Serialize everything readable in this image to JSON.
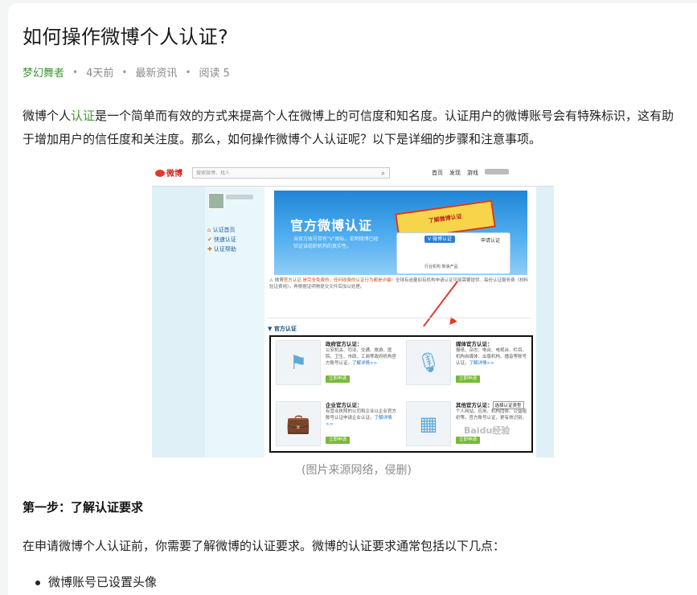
{
  "article": {
    "title": "如何操作微博个人认证?",
    "meta": {
      "author": "梦幻舞者",
      "time": "4天前",
      "category": "最新资讯",
      "reads": "阅读 5"
    },
    "intro": {
      "before": "微博个人",
      "keyword": "认证",
      "after": "是一个简单而有效的方式来提高个人在微博上的可信度和知名度。认证用户的微博账号会有特殊标识，这有助于增加用户的信任度和关注度。那么，如何操作微博个人认证呢？以下是详细的步骤和注意事项。"
    },
    "image_caption": "(图片来源网络，侵删)",
    "step1_heading": "第一步：了解认证要求",
    "step1_para": "在申请微博个人认证前，你需要了解微博的认证要求。微博的认证要求通常包括以下几点：",
    "bullets": [
      "微博账号已设置头像"
    ]
  },
  "screenshot": {
    "logo": "微博",
    "search_placeholder": "搜索微博、找人",
    "nav": [
      "首页",
      "发现",
      "游戏"
    ],
    "left_menu": [
      "认证首页",
      "快速认证",
      "认证帮助"
    ],
    "banner_title": "官方微博认证",
    "banner_sub": "当官方账号带有\"V\"图标，说明微博已经验证该组织机构的真实性。",
    "promo_text": "了解微博认证",
    "popup_btn": "V 微博认证",
    "popup_label": "申请认证",
    "popup_row": "行业机构 新浪产品",
    "warn_prefix": "微博",
    "warn_highlight": "官方认证 是完全免费的，任何收费的认证行为都是诈骗！",
    "warn_rest": "全球有逾量如有机构申请认证可能需要提供…每份认证服务费（材料验证费用）。再根据证明物提交文件后加以处理。",
    "section_head": "官方认证",
    "categories": [
      {
        "title": "政府官方认证：",
        "desc": "公安机关、司法、交通、旅游、医院、卫生、市政、工商等政府机构官方账号认证。",
        "more": "了解详情>>",
        "btn": "立即申请",
        "icon": "flag-icon",
        "glyph": "⚑"
      },
      {
        "title": "媒体官方认证：",
        "desc": "报纸、杂志、电台、电视台、栏目、机构自媒体、出版机构、播音等账号认证。",
        "more": "了解详情>>",
        "btn": "立即申请",
        "icon": "microphone-icon",
        "glyph": "🎙"
      },
      {
        "title": "企业官方认证：",
        "desc": "有营业执照的公司和企业以企业官方账号认证申请企业认证。",
        "more": "了解详情>>",
        "btn": "立即申请",
        "icon": "briefcase-icon",
        "glyph": "💼"
      },
      {
        "title": "其他官方认证：",
        "select": "选择认证类型",
        "desc": "个人网站、应用、机构团体、公益组织等。官方账号认证，更有效识别。",
        "more": "",
        "btn": "立即申请",
        "icon": "grid-icon",
        "glyph": "▦"
      }
    ],
    "watermark": "Baidu经验"
  },
  "colors": {
    "author_green": "#3f9a36",
    "weibo_red": "#d52b1e",
    "banner_blue": "#1f86d6",
    "apply_green": "#78b93a"
  }
}
